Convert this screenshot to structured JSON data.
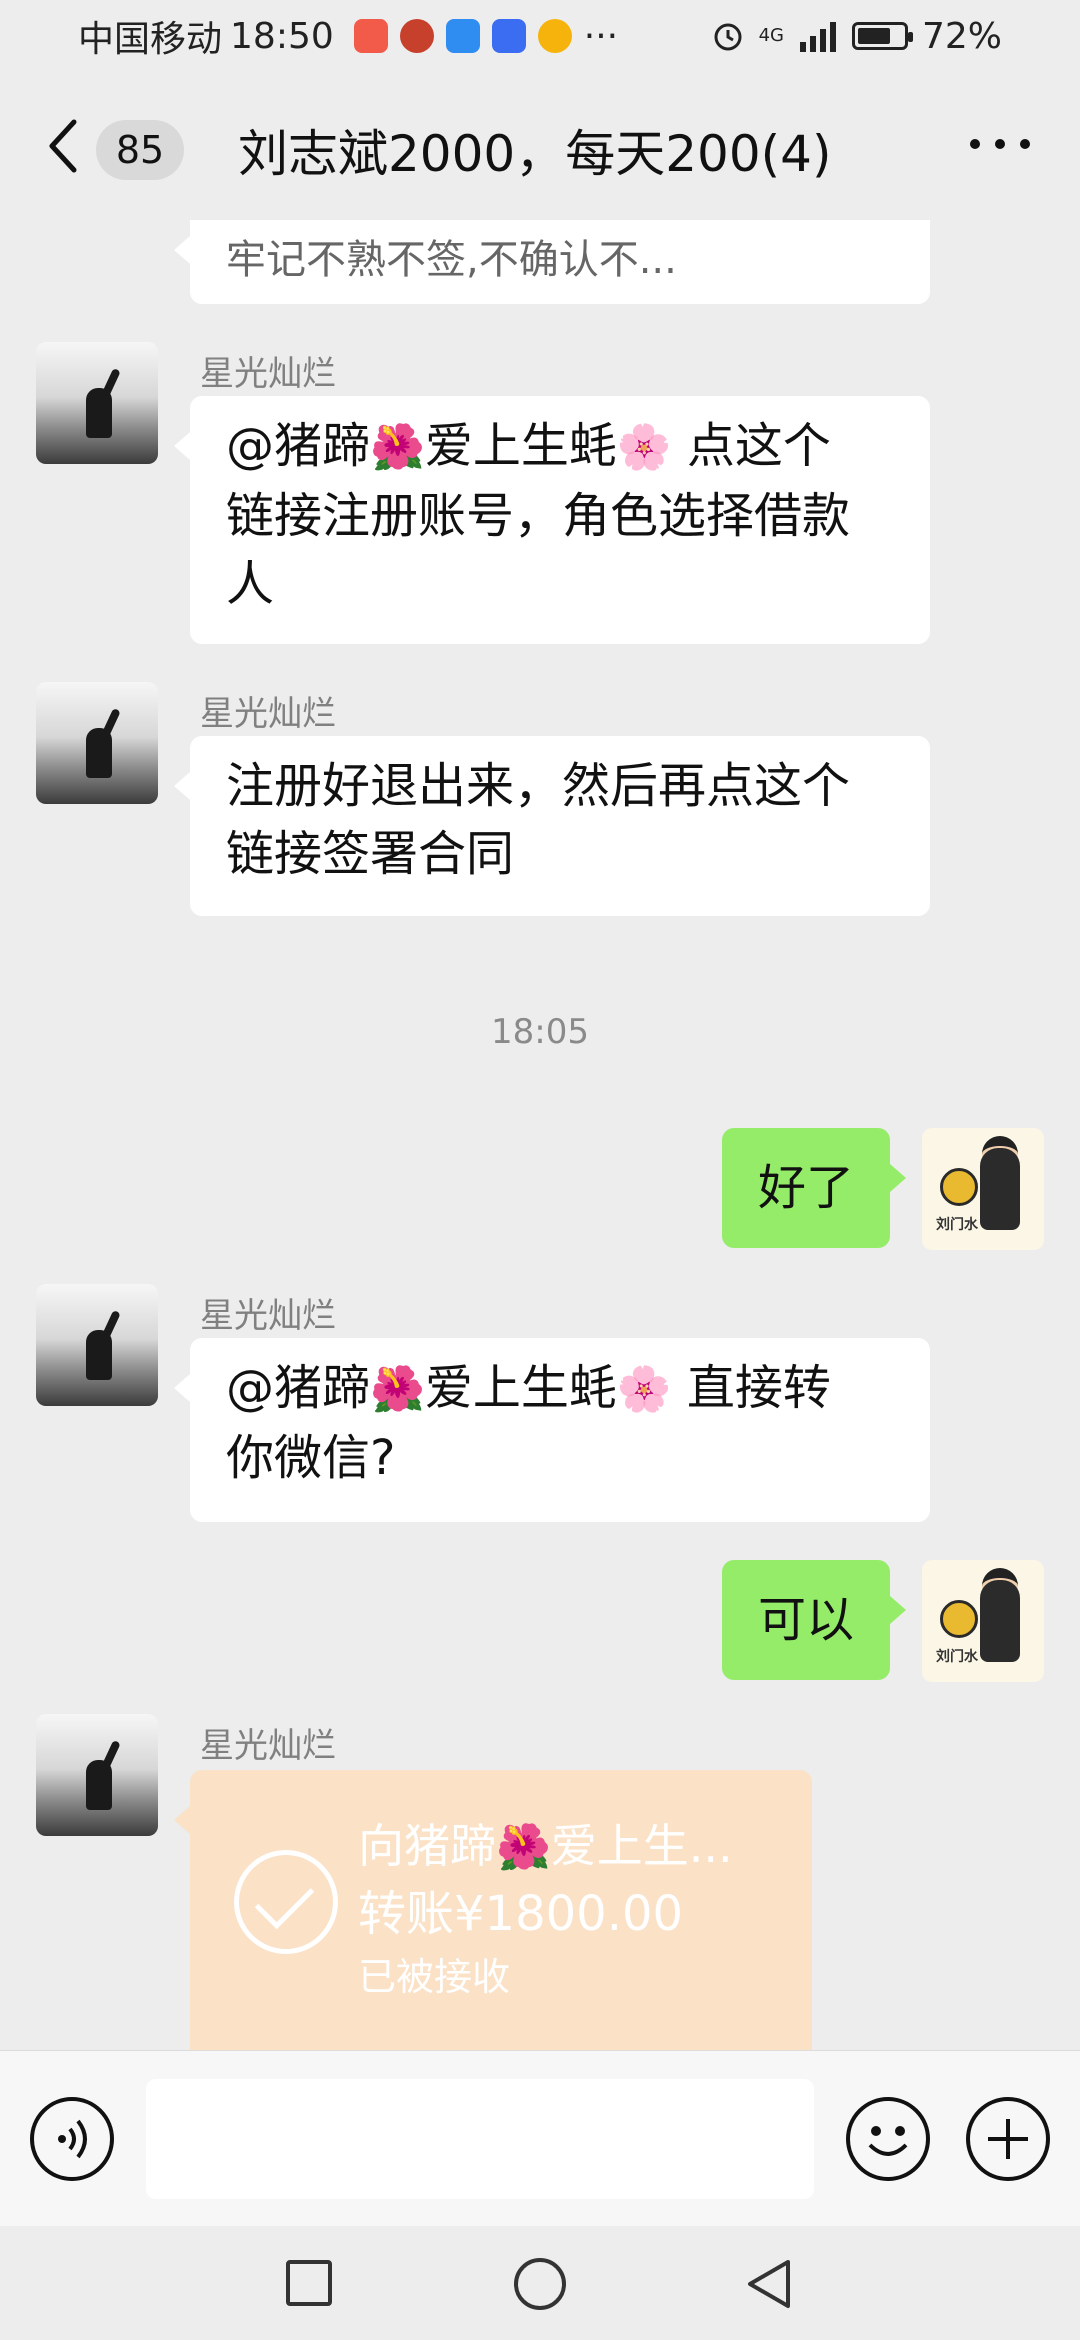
{
  "status_bar": {
    "carrier": "中国移动",
    "time": "18:50",
    "more": "···",
    "network": "4G",
    "battery": "72%",
    "battery_level": 0.72
  },
  "header": {
    "unread_count": "85",
    "title": "刘志斌2000，每天200(4)"
  },
  "messages": {
    "partial_prev": "牢记不熟不签,不确认不...",
    "m1": {
      "sender": "星光灿烂",
      "line1_a": "@猪蹄",
      "flower1": "🌺",
      "line1_b": "爱上生蚝",
      "flower2": "🌸",
      "line1_c": " 点这个",
      "line2": "链接注册账号，角色选择借款",
      "line3": "人"
    },
    "m2": {
      "sender": "星光灿烂",
      "line1": "注册好退出来，然后再点这个",
      "line2": "链接签署合同"
    },
    "timestamp": "18:05",
    "m3": {
      "text": "好了"
    },
    "m4": {
      "sender": "星光灿烂",
      "line1_a": "@猪蹄",
      "flower1": "🌺",
      "line1_b": "爱上生蚝",
      "flower2": "🌸",
      "line1_c": " 直接转",
      "line2": "你微信?"
    },
    "m5": {
      "text": "可以"
    },
    "m6": {
      "sender": "星光灿烂",
      "to_a": "向猪蹄",
      "flower": "🌺",
      "to_b": "爱上生...",
      "amount": "转账¥1800.00",
      "status": "已被接收"
    }
  },
  "my_avatar": {
    "badge_char": "刘",
    "caption": "刘门水"
  },
  "input": {
    "placeholder": ""
  }
}
